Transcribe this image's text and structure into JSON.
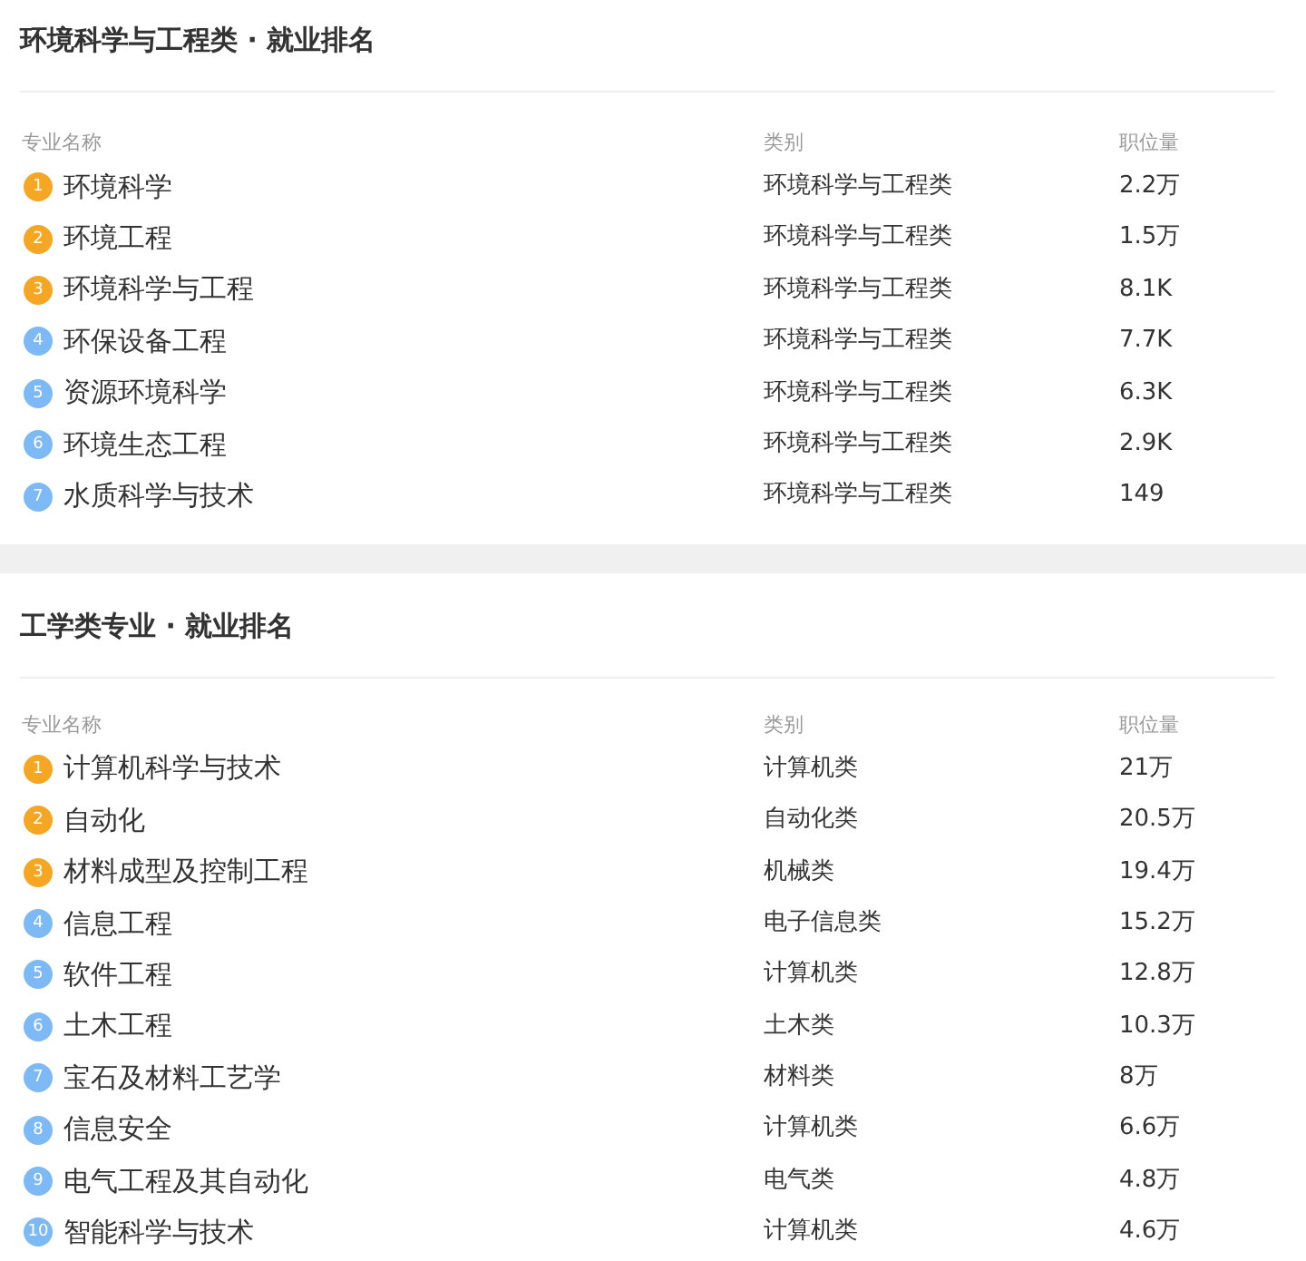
{
  "sections": [
    {
      "title": "环境科学与工程类 · 就业排名",
      "columns": [
        "专业名称",
        "类别",
        "职位量"
      ],
      "rows": [
        {
          "rank": "1",
          "color": "#f5a623",
          "name": "环境科学",
          "category": "环境科学与工程类",
          "jobs": "2.2万"
        },
        {
          "rank": "2",
          "color": "#f5a623",
          "name": "环境工程",
          "category": "环境科学与工程类",
          "jobs": "1.5万"
        },
        {
          "rank": "3",
          "color": "#f5a623",
          "name": "环境科学与工程",
          "category": "环境科学与工程类",
          "jobs": "8.1K"
        },
        {
          "rank": "4",
          "color": "#7db9f5",
          "name": "环保设备工程",
          "category": "环境科学与工程类",
          "jobs": "7.7K"
        },
        {
          "rank": "5",
          "color": "#7db9f5",
          "name": "资源环境科学",
          "category": "环境科学与工程类",
          "jobs": "6.3K"
        },
        {
          "rank": "6",
          "color": "#7db9f5",
          "name": "环境生态工程",
          "category": "环境科学与工程类",
          "jobs": "2.9K"
        },
        {
          "rank": "7",
          "color": "#7db9f5",
          "name": "水质科学与技术",
          "category": "环境科学与工程类",
          "jobs": "149"
        }
      ]
    },
    {
      "title": "工学类专业 · 就业排名",
      "columns": [
        "专业名称",
        "类别",
        "职位量"
      ],
      "rows": [
        {
          "rank": "1",
          "color": "#f5a623",
          "name": "计算机科学与技术",
          "category": "计算机类",
          "jobs": "21万"
        },
        {
          "rank": "2",
          "color": "#f5a623",
          "name": "自动化",
          "category": "自动化类",
          "jobs": "20.5万"
        },
        {
          "rank": "3",
          "color": "#f5a623",
          "name": "材料成型及控制工程",
          "category": "机械类",
          "jobs": "19.4万"
        },
        {
          "rank": "4",
          "color": "#7db9f5",
          "name": "信息工程",
          "category": "电子信息类",
          "jobs": "15.2万"
        },
        {
          "rank": "5",
          "color": "#7db9f5",
          "name": "软件工程",
          "category": "计算机类",
          "jobs": "12.8万"
        },
        {
          "rank": "6",
          "color": "#7db9f5",
          "name": "土木工程",
          "category": "土木类",
          "jobs": "10.3万"
        },
        {
          "rank": "7",
          "color": "#7db9f5",
          "name": "宝石及材料工艺学",
          "category": "材料类",
          "jobs": "8万"
        },
        {
          "rank": "8",
          "color": "#7db9f5",
          "name": "信息安全",
          "category": "计算机类",
          "jobs": "6.6万"
        },
        {
          "rank": "9",
          "color": "#7db9f5",
          "name": "电气工程及其自动化",
          "category": "电气类",
          "jobs": "4.8万"
        },
        {
          "rank": "10",
          "color": "#7db9f5",
          "name": "智能科学与技术",
          "category": "计算机类",
          "jobs": "4.6万"
        }
      ]
    }
  ]
}
